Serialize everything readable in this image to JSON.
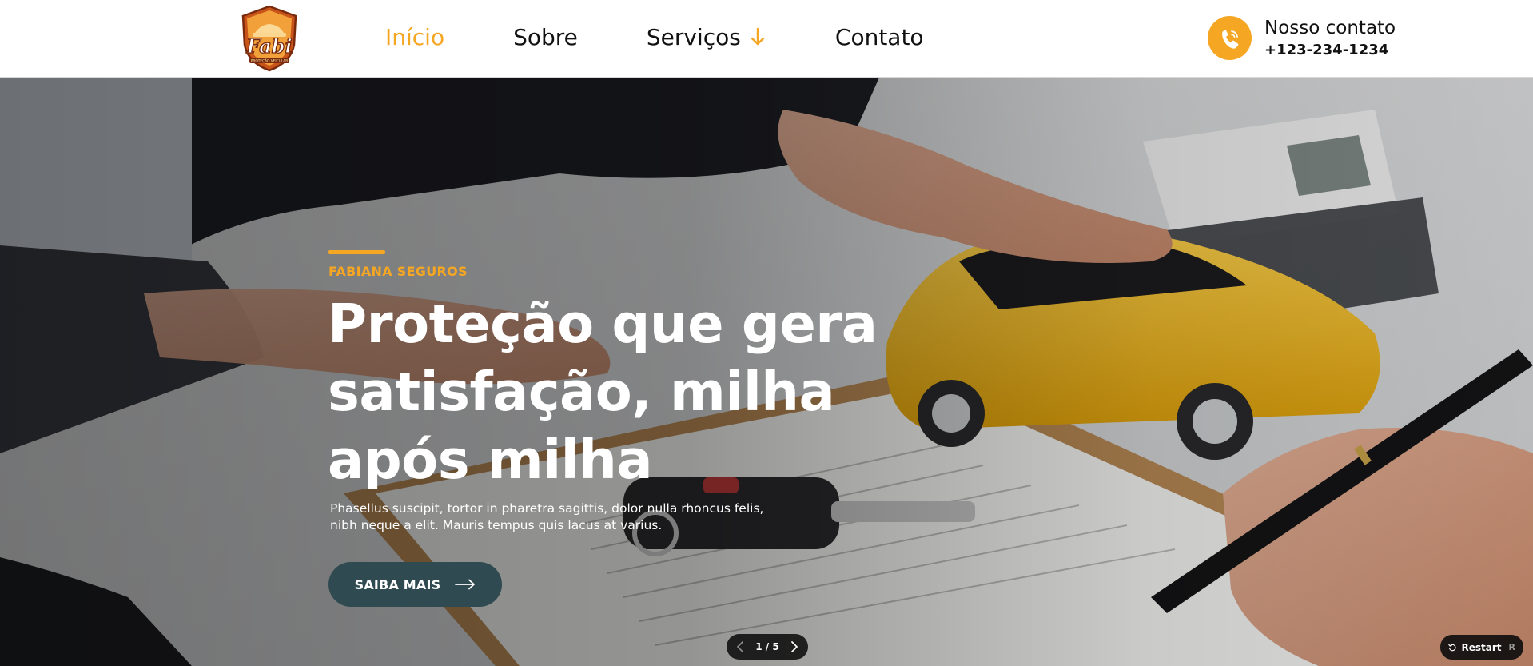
{
  "header": {
    "logo_text": "Fabi",
    "logo_tagline": "PROTEÇÃO VEICULAR",
    "nav": [
      {
        "label": "Início",
        "active": true
      },
      {
        "label": "Sobre",
        "active": false
      },
      {
        "label": "Serviços",
        "active": false,
        "has_dropdown": true
      },
      {
        "label": "Contato",
        "active": false
      }
    ],
    "contact": {
      "title": "Nosso contato",
      "phone": "+123-234-1234",
      "icon": "phone-icon"
    }
  },
  "hero": {
    "eyebrow": "FABIANA SEGUROS",
    "headline": "Proteção que gera satisfação, milha após milha",
    "description": "Phasellus suscipit, tortor in pharetra sagittis, dolor nulla rhoncus felis, nibh neque a elit. Mauris tempus quis lacus at varius.",
    "cta_label": "SAIBA MAIS"
  },
  "slider": {
    "counter": "1 / 5",
    "current": 1,
    "total": 5
  },
  "restart": {
    "label": "Restart",
    "shortcut": "R"
  },
  "colors": {
    "accent": "#f5a623",
    "cta_bg": "#2f4a50",
    "text_dark": "#111111"
  }
}
